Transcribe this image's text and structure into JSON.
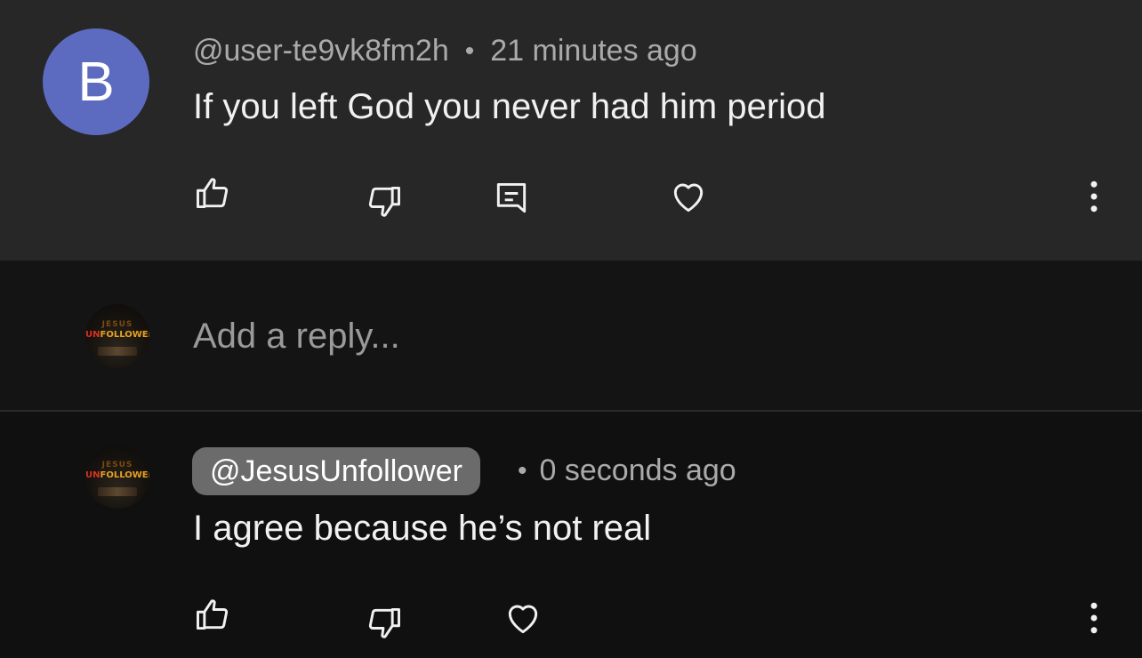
{
  "colors": {
    "avatar_bg": "#5c6bc0",
    "top_bg": "#272727",
    "input_bg": "#141414",
    "bottom_bg": "#101010",
    "chip_bg": "#6b6b6b"
  },
  "top_comment": {
    "avatar_letter": "B",
    "author": "@user-te9vk8fm2h",
    "separator": "•",
    "time": "21 minutes ago",
    "text": "If you left God you never had him period",
    "actions": [
      "like-icon",
      "dislike-icon",
      "reply-icon",
      "heart-icon",
      "more-vertical-icon"
    ]
  },
  "reply_input": {
    "placeholder": "Add a reply..."
  },
  "channel_avatar": {
    "top_word": "JESUS",
    "main_word_prefix": "UN",
    "main_word_rest": "FOLLOWER"
  },
  "reply": {
    "author": "@JesusUnfollower",
    "separator": "•",
    "time": "0 seconds ago",
    "text": "I agree because he’s not real",
    "actions": [
      "like-icon",
      "dislike-icon",
      "heart-icon",
      "more-vertical-icon"
    ]
  }
}
